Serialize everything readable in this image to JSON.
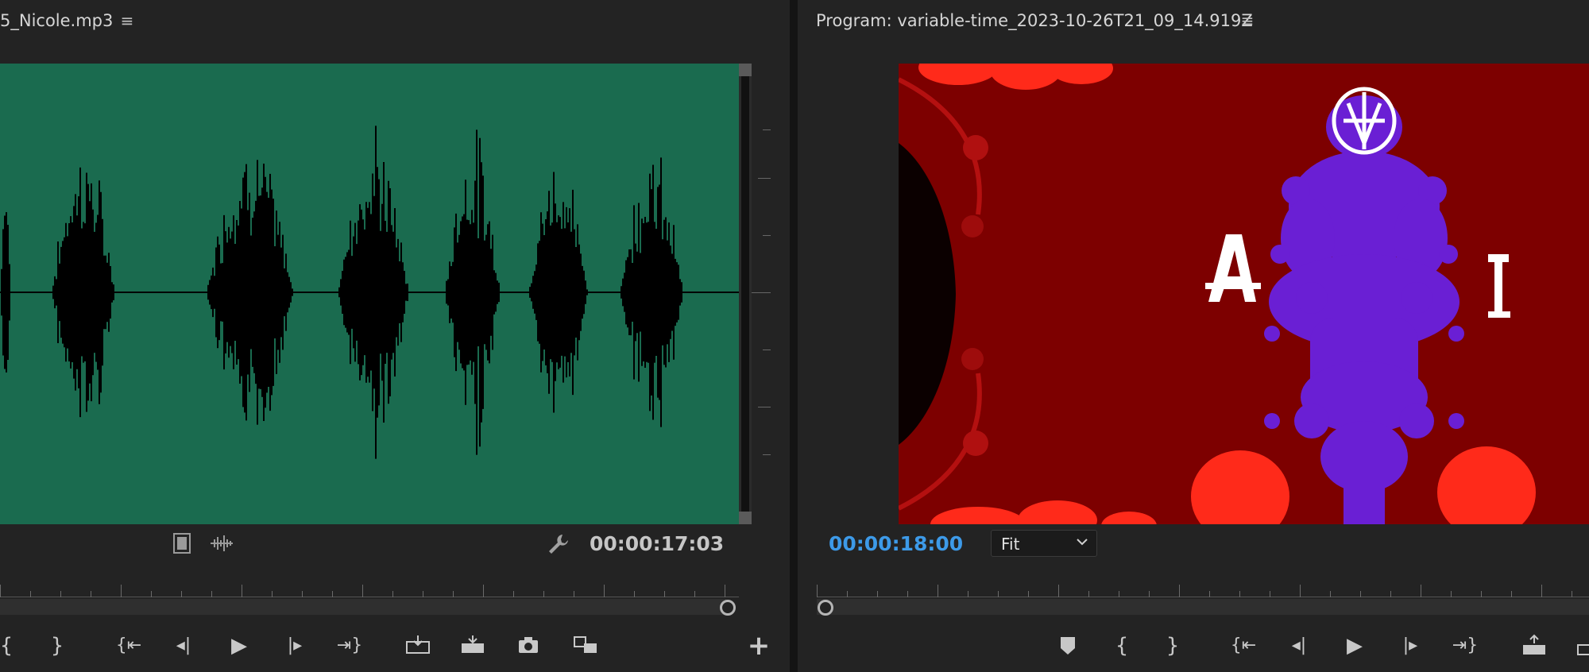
{
  "source": {
    "title": "5_Nicole.mp3",
    "timecode": "00:00:17:03",
    "colors": {
      "background": "#1a6b4f",
      "waveform": "#000000"
    }
  },
  "program": {
    "title": "Program: variable-time_2023-10-26T21_09_14.919Z",
    "timecode": "00:00:18:00",
    "zoom": {
      "selected": "Fit"
    },
    "colors": {
      "timecode": "#3d9ae8",
      "frame_bg": "#7d0000"
    }
  },
  "icons": {
    "menu": "hamburger-menu-icon",
    "settings": "wrench-icon",
    "drag_video": "film-strip-icon",
    "drag_audio": "audio-waveform-icon",
    "add": "plus-icon",
    "marker": "marker-icon",
    "mark_in": "mark-in-icon",
    "mark_out": "mark-out-icon",
    "go_to_in": "go-to-in-icon",
    "step_back": "step-back-icon",
    "play": "play-icon",
    "step_forward": "step-forward-icon",
    "go_to_out": "go-to-out-icon",
    "insert": "insert-icon",
    "overwrite": "overwrite-icon",
    "export_frame": "camera-icon",
    "lift": "lift-icon"
  },
  "glyphs": {
    "menu": "≡",
    "wrench": "🔧",
    "plus": "+",
    "chevron": "⌄",
    "mark_in": "{",
    "mark_out": "}",
    "go_in": "{⇤",
    "step_back": "◂|",
    "play": "▶",
    "step_fwd": "|▸",
    "go_out": "⇥}"
  }
}
